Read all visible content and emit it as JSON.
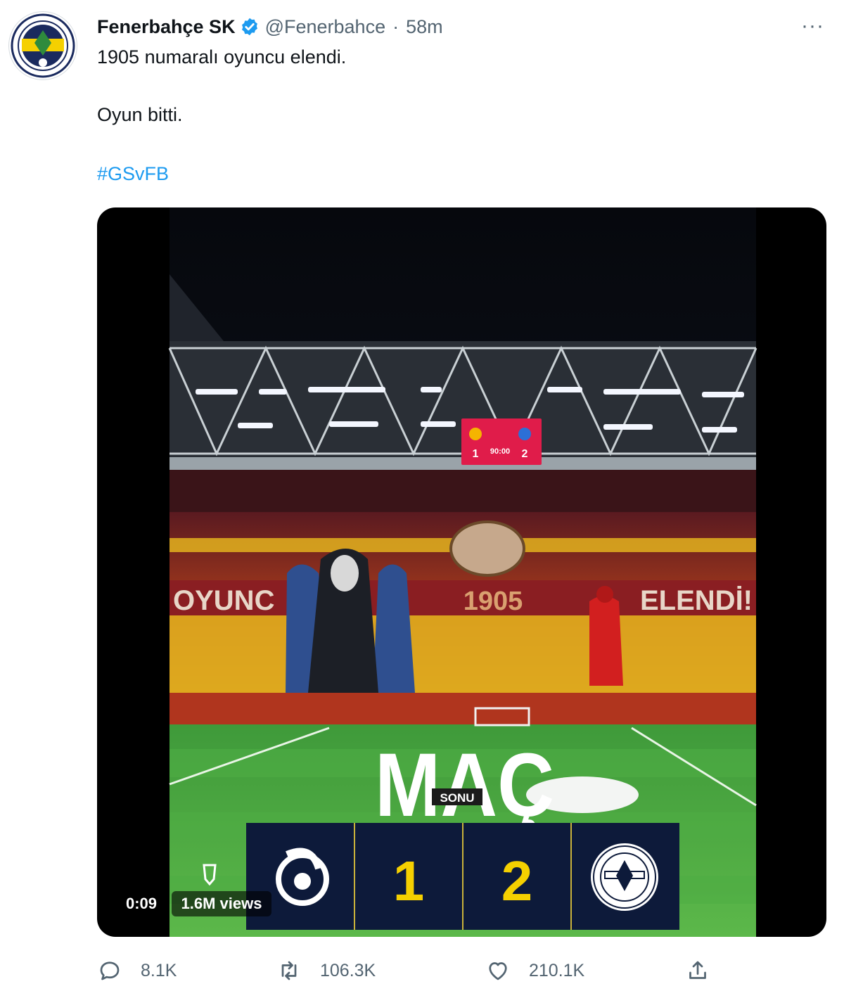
{
  "tweet": {
    "author_name": "Fenerbahçe SK",
    "handle": "@Fenerbahce",
    "separator": "·",
    "time": "58m",
    "more_label": "···",
    "text_line1": "1905 numaralı oyuncu elendi.",
    "text_line2": "Oyun bitti.",
    "hashtag": "#GSvFB"
  },
  "media": {
    "scoreboard_left": "1",
    "scoreboard_clock": "90:00",
    "scoreboard_right": "2",
    "banner_left": "OYUNC",
    "banner_center": "1905",
    "banner_right": "ELENDİ!",
    "overlay_title": "MAÇ",
    "overlay_subtitle": "SONU",
    "home_score": "1",
    "away_score": "2",
    "video_time": "0:09",
    "views": "1.6M views"
  },
  "actions": {
    "replies": "8.1K",
    "retweets": "106.3K",
    "likes": "210.1K"
  },
  "colors": {
    "accent": "#1d9bf0",
    "secondary_text": "#536471",
    "score_yellow": "#f5d000",
    "score_panel": "#0d1a3a",
    "scoreboard_red": "#e01c4a"
  }
}
